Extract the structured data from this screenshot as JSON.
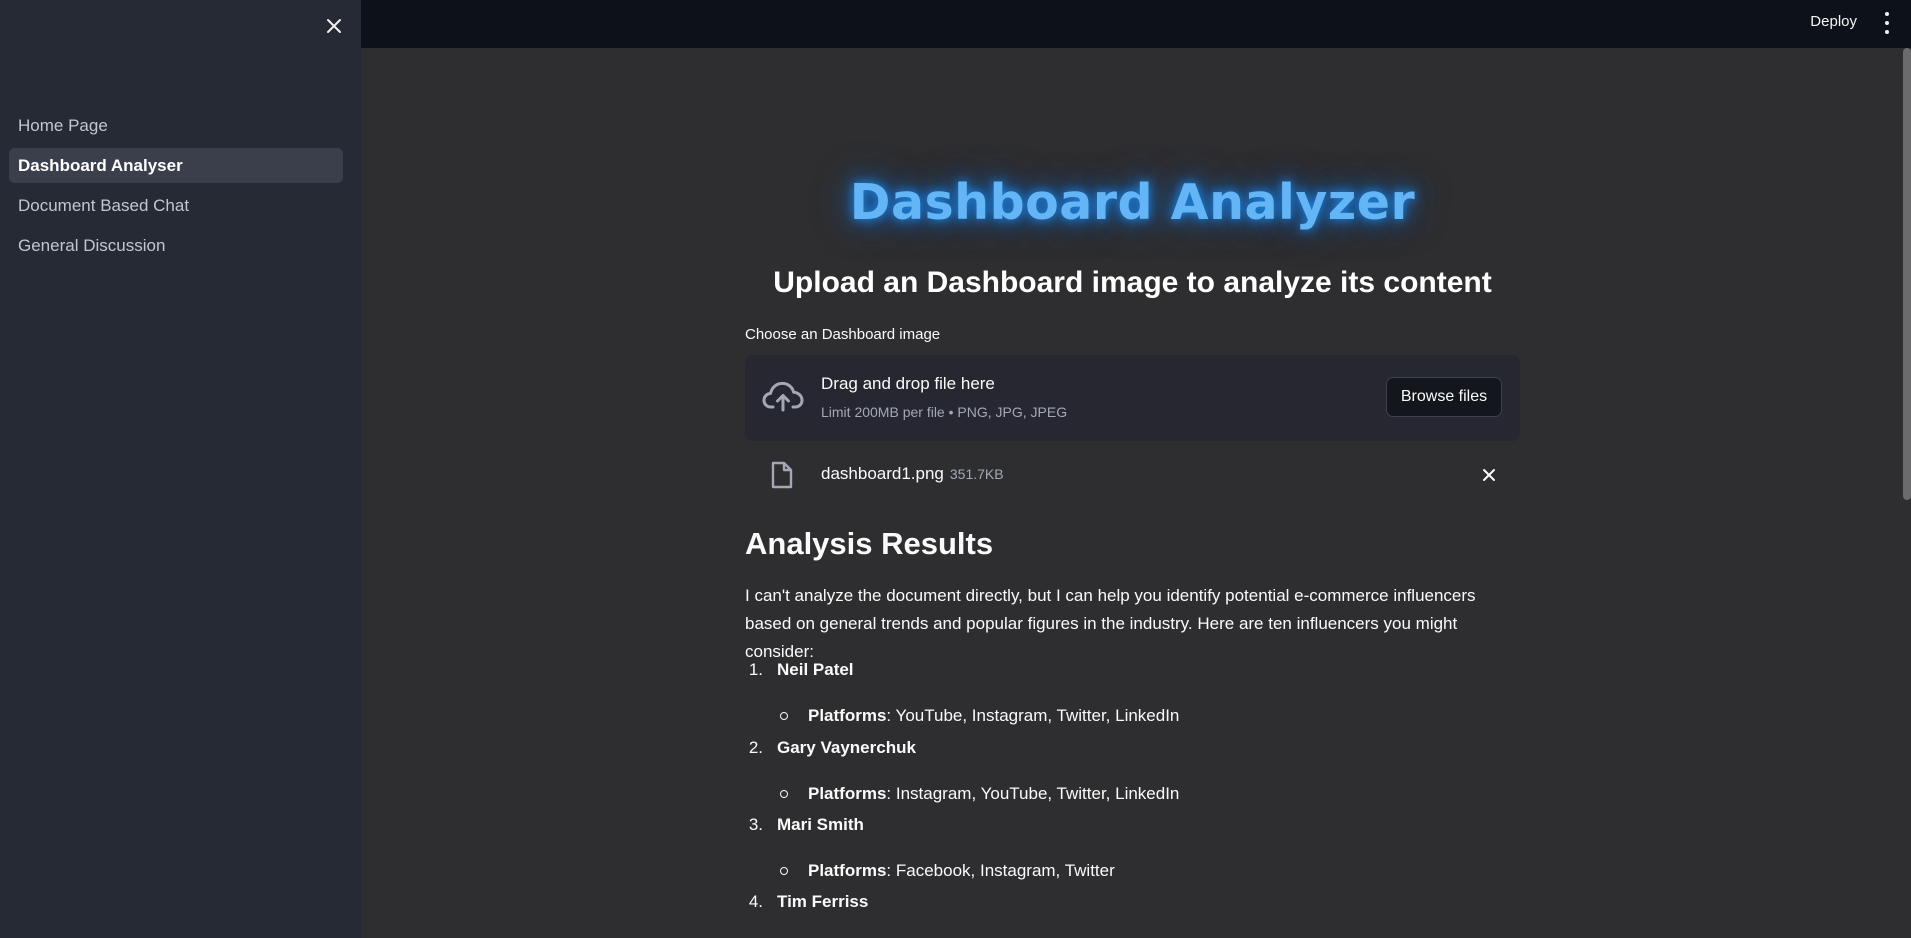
{
  "sidebar": {
    "items": [
      {
        "label": "Home Page",
        "active": false
      },
      {
        "label": "Dashboard Analyser",
        "active": true
      },
      {
        "label": "Document Based Chat",
        "active": false
      },
      {
        "label": "General Discussion",
        "active": false
      }
    ],
    "close_icon": "close-icon"
  },
  "header": {
    "deploy_label": "Deploy",
    "menu_icon": "vertical-dots-icon"
  },
  "main": {
    "title": "Dashboard Analyzer",
    "subtitle": "Upload an Dashboard image to analyze its content",
    "uploader": {
      "label": "Choose an Dashboard image",
      "drag_text": "Drag and drop file here",
      "limit_text": "Limit 200MB per file • PNG, JPG, JPEG",
      "browse_label": "Browse files",
      "file": {
        "name": "dashboard1.png",
        "size": "351.7KB"
      }
    },
    "results": {
      "heading": "Analysis Results",
      "intro": "I can't analyze the document directly, but I can help you identify potential e-commerce influencers based on general trends and popular figures in the industry. Here are ten influencers you might consider:",
      "platforms_label": "Platforms",
      "influencers": [
        {
          "num": "1.",
          "name": "Neil Patel",
          "platforms": ": YouTube, Instagram, Twitter, LinkedIn"
        },
        {
          "num": "2.",
          "name": "Gary Vaynerchuk",
          "platforms": ": Instagram, YouTube, Twitter, LinkedIn"
        },
        {
          "num": "3.",
          "name": "Mari Smith",
          "platforms": ": Facebook, Instagram, Twitter"
        },
        {
          "num": "4.",
          "name": "Tim Ferriss",
          "platforms": ""
        }
      ]
    }
  },
  "colors": {
    "sidebar_bg": "#262a35",
    "main_bg": "#2e2e30",
    "header_bg": "#0d1119",
    "title_glow": "#64b5f6"
  }
}
